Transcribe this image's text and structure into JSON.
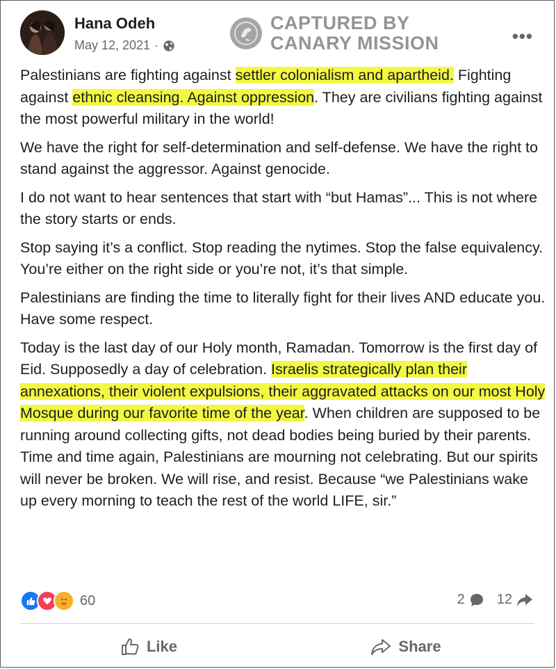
{
  "post": {
    "author": "Hana Odeh",
    "date": "May 12, 2021",
    "date_separator": "·",
    "more_label": "•••"
  },
  "watermark": {
    "line1": "CAPTURED BY",
    "line2": "CANARY MISSION"
  },
  "body": {
    "p1_a": "Palestinians are fighting against ",
    "p1_h1": "settler colonialism and apartheid.",
    "p1_b": " Fighting against ",
    "p1_h2": "ethnic cleansing. Against oppression",
    "p1_c": ". They are civilians fighting against the most powerful military in the world!",
    "p2": "We have the right for self-determination and self-defense. We have the right to stand against the aggressor. Against genocide.",
    "p3": "I do not want to hear sentences that start with “but Hamas”... This is not where the story starts or ends.",
    "p4": "Stop saying it’s a conflict. Stop reading the nytimes. Stop the false equivalency. You’re either on the right side or you’re not, it’s that simple.",
    "p5": "Palestinians are finding the time to literally fight for their lives AND educate you. Have some respect.",
    "p6_a": "Today is the last day of our Holy month, Ramadan. Tomorrow is the first day of Eid. Supposedly a day of celebration. ",
    "p6_h": "Israelis strategically plan their annexations, their violent expulsions, their aggravated attacks on our most Holy Mosque during our favorite time of the year",
    "p6_b": ". When children are supposed to be running around collecting gifts, not dead bodies being buried by their parents. Time and time again, Palestinians are mourning not celebrating. But our spirits will never be broken. We will rise, and resist. Because “we Palestinians wake up every morning to teach the rest of the world LIFE, sir.”"
  },
  "stats": {
    "reactions_count": "60",
    "comments_count": "2",
    "shares_count": "12"
  },
  "actions": {
    "like_label": "Like",
    "share_label": "Share"
  },
  "colors": {
    "highlight": "#f3f842",
    "like_blue": "#1877f2",
    "love_red": "#f33e58",
    "care_yellow": "#f7b125",
    "secondary_text": "#65676b"
  },
  "icons": {
    "privacy": "globe-icon",
    "comments": "comment-bubble-icon",
    "shares": "share-arrow-icon",
    "like_action": "thumbs-up-icon",
    "share_action": "share-arrow-outline-icon"
  }
}
